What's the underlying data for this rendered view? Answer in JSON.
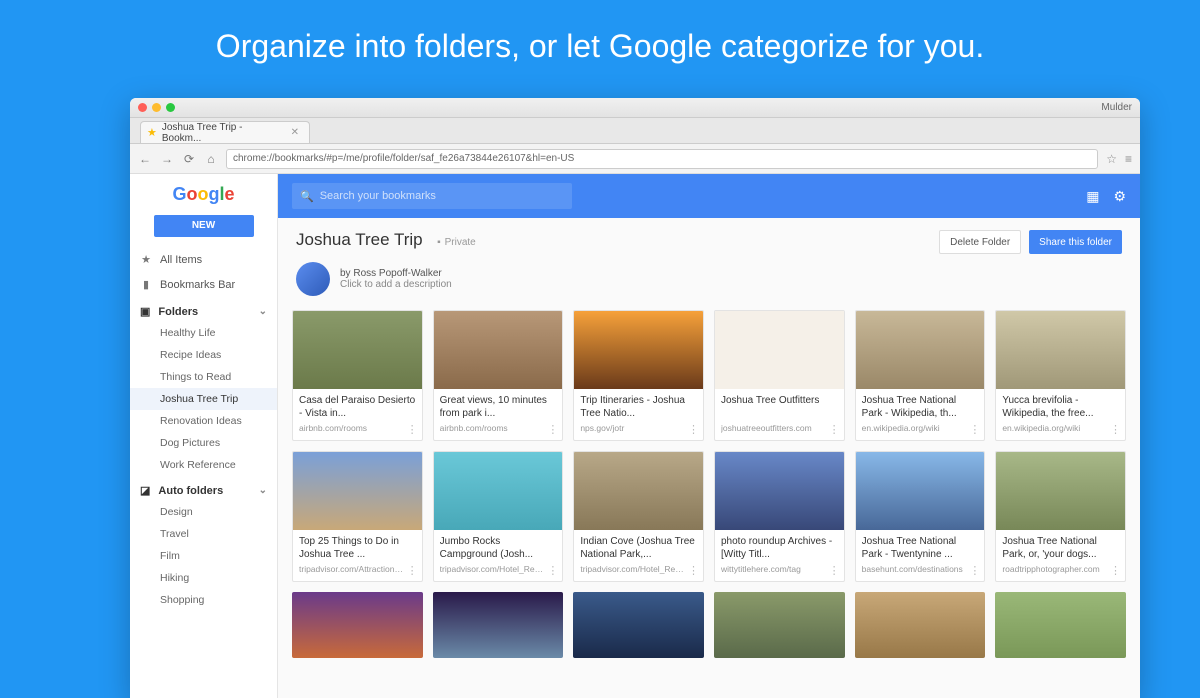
{
  "headline": "Organize into folders, or let Google categorize for you.",
  "browser": {
    "os_user": "Mulder",
    "tab_title": "Joshua Tree Trip - Bookm...",
    "url": "chrome://bookmarks/#p=/me/profile/folder/saf_fe26a73844e26107&hl=en-US",
    "logo_letters": [
      "G",
      "o",
      "o",
      "g",
      "l",
      "e"
    ],
    "new_button": "NEW"
  },
  "sidebar": {
    "all_items": "All Items",
    "bookmarks_bar": "Bookmarks Bar",
    "folders_label": "Folders",
    "folders": [
      {
        "label": "Healthy Life",
        "active": false
      },
      {
        "label": "Recipe Ideas",
        "active": false
      },
      {
        "label": "Things to Read",
        "active": false
      },
      {
        "label": "Joshua Tree Trip",
        "active": true
      },
      {
        "label": "Renovation Ideas",
        "active": false
      },
      {
        "label": "Dog Pictures",
        "active": false
      },
      {
        "label": "Work Reference",
        "active": false
      }
    ],
    "auto_label": "Auto folders",
    "auto": [
      "Design",
      "Travel",
      "Film",
      "Hiking",
      "Shopping"
    ]
  },
  "search": {
    "placeholder": "Search your bookmarks"
  },
  "folder": {
    "title": "Joshua Tree Trip",
    "privacy": "Private",
    "delete_btn": "Delete Folder",
    "share_btn": "Share this folder",
    "by_prefix": "by",
    "author": "Ross Popoff-Walker",
    "desc_prompt": "Click to add a description"
  },
  "cards_row1": [
    {
      "title": "Casa del Paraiso Desierto - Vista in...",
      "url": "airbnb.com/rooms",
      "bg": "linear-gradient(#8a9a6a,#6b7a4a)"
    },
    {
      "title": "Great views, 10 minutes from park i...",
      "url": "airbnb.com/rooms",
      "bg": "linear-gradient(#b89878,#8a6a4a)"
    },
    {
      "title": "Trip Itineraries - Joshua Tree Natio...",
      "url": "nps.gov/jotr",
      "bg": "linear-gradient(#f6a13a,#6a3a1a)"
    },
    {
      "title": "Joshua Tree Outfitters",
      "url": "joshuatreeoutfitters.com",
      "bg": "#f5f0e8"
    },
    {
      "title": "Joshua Tree National Park - Wikipedia, th...",
      "url": "en.wikipedia.org/wiki",
      "bg": "linear-gradient(#c8b898,#9a8868)"
    },
    {
      "title": "Yucca brevifolia - Wikipedia, the free...",
      "url": "en.wikipedia.org/wiki",
      "bg": "linear-gradient(#d0c8a8,#a09878)"
    }
  ],
  "cards_row2": [
    {
      "title": "Top 25 Things to Do in Joshua Tree ...",
      "url": "tripadvisor.com/Attractions-g",
      "bg": "linear-gradient(#7aa0d8,#c8a878)"
    },
    {
      "title": "Jumbo Rocks Campground (Josh...",
      "url": "tripadvisor.com/Hotel_Review",
      "bg": "linear-gradient(#6ac8d8,#48a8b8)"
    },
    {
      "title": "Indian Cove (Joshua Tree National Park,...",
      "url": "tripadvisor.com/Hotel_Review",
      "bg": "linear-gradient(#b8a888,#887858)"
    },
    {
      "title": "photo roundup Archives - [Witty Titl...",
      "url": "wittytitlehere.com/tag",
      "bg": "linear-gradient(#6888c8,#384878)"
    },
    {
      "title": "Joshua Tree National Park - Twentynine ...",
      "url": "basehunt.com/destinations",
      "bg": "linear-gradient(#88b8e8,#486898)"
    },
    {
      "title": "Joshua Tree National Park, or, 'your dogs...",
      "url": "roadtripphotographer.com",
      "bg": "linear-gradient(#a8b888,#788858)"
    }
  ],
  "cards_row3": [
    {
      "bg": "linear-gradient(#6a3a8a,#c86a3a)"
    },
    {
      "bg": "linear-gradient(#2a1a4a,#6a8aa8)"
    },
    {
      "bg": "linear-gradient(#3a5a8a,#1a2a4a)"
    },
    {
      "bg": "linear-gradient(#8a9a6a,#5a6a4a)"
    },
    {
      "bg": "linear-gradient(#c8a878,#987848)"
    },
    {
      "bg": "linear-gradient(#9ab878,#7a9858)"
    }
  ]
}
